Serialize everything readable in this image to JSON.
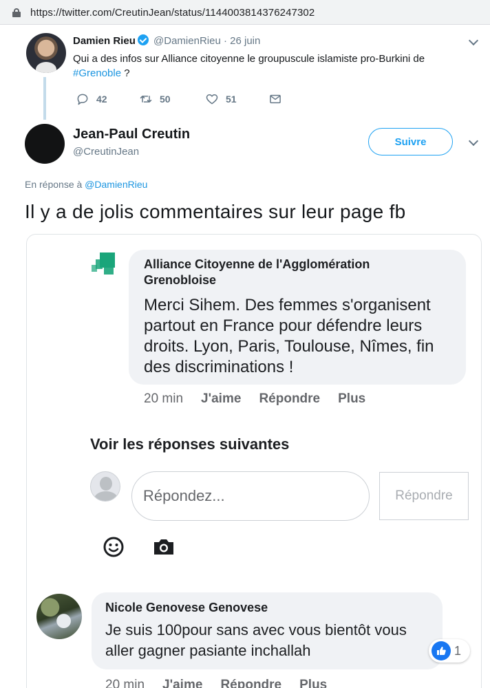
{
  "browser": {
    "url": "https://twitter.com/CreutinJean/status/1144003814376247302"
  },
  "parent_tweet": {
    "name": "Damien Rieu",
    "handle": "@DamienRieu",
    "separator": "·",
    "date": "26 juin",
    "text_line1": "Qui a des infos sur Alliance citoyenne le groupuscule islamiste pro-Burkini de",
    "hashtag": "#Grenoble",
    "text_end": " ?",
    "replies": "42",
    "retweets": "50",
    "likes": "51"
  },
  "tweet": {
    "name": "Jean-Paul Creutin",
    "handle": "@CreutinJean",
    "follow_label": "Suivre",
    "reply_prefix": "En réponse à ",
    "reply_mention": "@DamienRieu",
    "text": "Il y a de jolis commentaires sur leur page fb"
  },
  "fb": {
    "comment1": {
      "author": "Alliance Citoyenne de l'Agglomération Grenobloise",
      "text": "Merci Sihem. Des femmes s'organisent partout en France pour défendre leurs droits. Lyon, Paris, Toulouse, Nîmes, fin des discriminations !",
      "time": "20 min",
      "like": "J'aime",
      "reply": "Répondre",
      "more": "Plus"
    },
    "see_more": "Voir les réponses suivantes",
    "input_placeholder": "Répondez...",
    "reply_button": "Répondre",
    "comment2": {
      "author": "Nicole Genovese Genovese",
      "text": "Je suis 100pour sans avec vous bientôt vous aller gagner pasiante inchallah",
      "like_count": "1",
      "time": "20 min",
      "like": "J'aime",
      "reply": "Répondre",
      "more": "Plus"
    }
  },
  "colors": {
    "twitter_blue": "#1da1f2",
    "link_blue": "#1b95e0",
    "fb_blue": "#1877f2",
    "muted": "#657786",
    "bubble": "#f0f2f5"
  },
  "icons": [
    "lock-icon",
    "verified-icon",
    "reply-icon",
    "retweet-icon",
    "like-icon",
    "dm-icon",
    "chevron-down-icon",
    "emoji-icon",
    "camera-icon",
    "thumbs-up-icon"
  ]
}
